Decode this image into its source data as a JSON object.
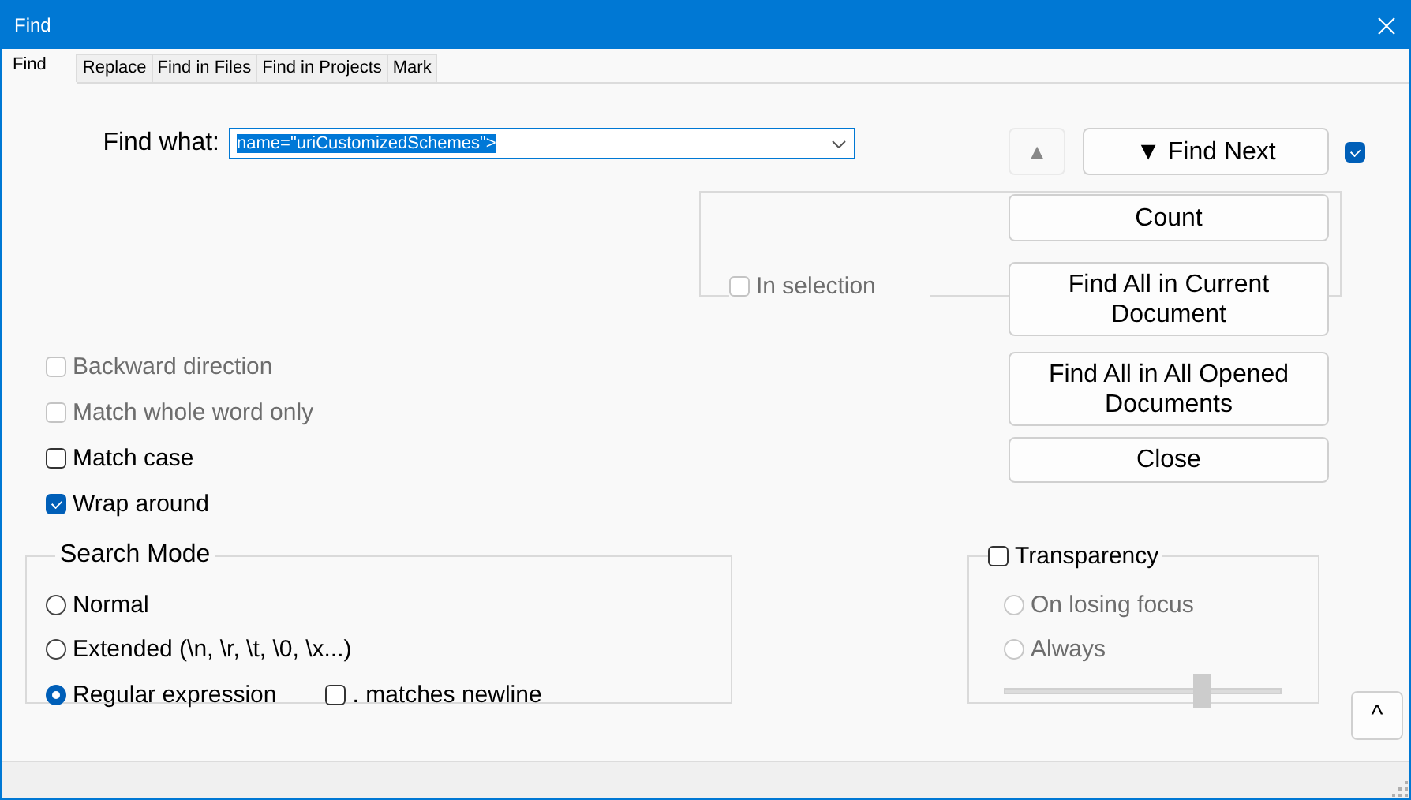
{
  "window": {
    "title": "Find"
  },
  "tabs": [
    {
      "label": "Find",
      "selected": true
    },
    {
      "label": "Replace",
      "selected": false
    },
    {
      "label": "Find in Files",
      "selected": false
    },
    {
      "label": "Find in Projects",
      "selected": false
    },
    {
      "label": "Mark",
      "selected": false
    }
  ],
  "find_what": {
    "label": "Find what:",
    "value": "name=\"uriCustomizedSchemes\">",
    "text_selected": true
  },
  "find_previous_button": {
    "label": "▲"
  },
  "find_next_button": {
    "label": "▼ Find Next"
  },
  "find_next_option": {
    "checked": true
  },
  "action_buttons": [
    {
      "label": "Count"
    },
    {
      "label": "Find All in Current Document"
    },
    {
      "label": "Find All in All Opened Documents"
    },
    {
      "label": "Close"
    }
  ],
  "in_selection": {
    "label": "In selection",
    "checked": false,
    "disabled": true
  },
  "options": [
    {
      "label": "Backward direction",
      "checked": false,
      "disabled": true
    },
    {
      "label": "Match whole word only",
      "checked": false,
      "disabled": true
    },
    {
      "label": "Match case",
      "checked": false,
      "disabled": false
    },
    {
      "label": "Wrap around",
      "checked": true,
      "disabled": false
    }
  ],
  "search_mode": {
    "title": "Search Mode",
    "modes": [
      {
        "label": "Normal",
        "selected": false
      },
      {
        "label": "Extended (\\n, \\r, \\t, \\0, \\x...)",
        "selected": false
      },
      {
        "label": "Regular expression",
        "selected": true
      }
    ],
    "dot_matches_newline": {
      "label": ". matches newline",
      "checked": false,
      "disabled": false
    }
  },
  "transparency": {
    "label": "Transparency",
    "checked": false,
    "disabled": false,
    "modes": [
      {
        "label": "On losing focus",
        "selected": false,
        "disabled": true
      },
      {
        "label": "Always",
        "selected": false,
        "disabled": true
      }
    ],
    "slider": {
      "level": 0.71,
      "disabled": true
    }
  },
  "collapse_button": {
    "label": "^"
  }
}
